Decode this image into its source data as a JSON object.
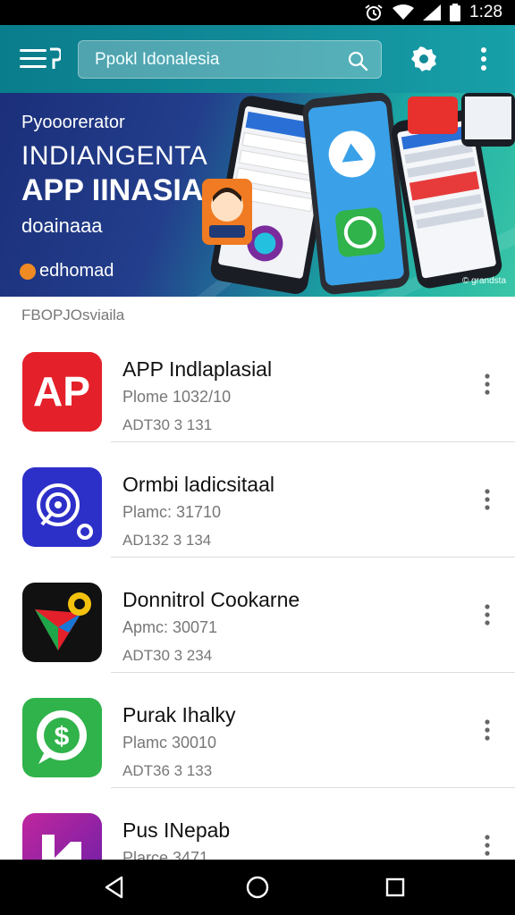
{
  "status_bar": {
    "time": "1:28",
    "icons": [
      "alarm-icon",
      "wifi-icon",
      "signal-icon",
      "battery-icon"
    ]
  },
  "toolbar": {
    "search_text": "Ppok⁠l Idonalesia",
    "icons": [
      "hamburger-menu-icon",
      "search-icon",
      "settings-gear-icon",
      "more-vert-icon"
    ]
  },
  "banner": {
    "subtitle": "Pyooorerator",
    "headline_1": "INDIANGENTA",
    "headline_2": "APP IINASIA",
    "caption": "doainaaa",
    "brand": "edhomad",
    "watermark": "© grandsta"
  },
  "section": {
    "label": "FBOPJOsviaila"
  },
  "apps": [
    {
      "title": "APP Indlaplasial",
      "subtitle": "Plome 1032/10",
      "meta": "ADT30 3 131",
      "icon": "ap-app-icon",
      "color": "#e4202a"
    },
    {
      "title": "Ormbi ladicsitaal",
      "subtitle": "Plamc: 31710",
      "meta": "AD132 3 134",
      "icon": "target-app-icon",
      "color": "#2d2fc9"
    },
    {
      "title": "Donnitrol Cookarne",
      "subtitle": "Apmc: 30071",
      "meta": "ADT30 3 234",
      "icon": "play-arrow-app-icon",
      "color": "#111111"
    },
    {
      "title": "Purak Ihalky",
      "subtitle": "Plamc  30010",
      "meta": "ADT36 3 133",
      "icon": "dollar-chat-app-icon",
      "color": "#2fb34a"
    },
    {
      "title": "Pus INepab",
      "subtitle": "Plarce  3471",
      "meta": "",
      "icon": "n-logo-app-icon",
      "color": "#a0208f"
    }
  ],
  "nav": {
    "icons": [
      "back-icon",
      "home-icon",
      "recents-icon"
    ]
  }
}
